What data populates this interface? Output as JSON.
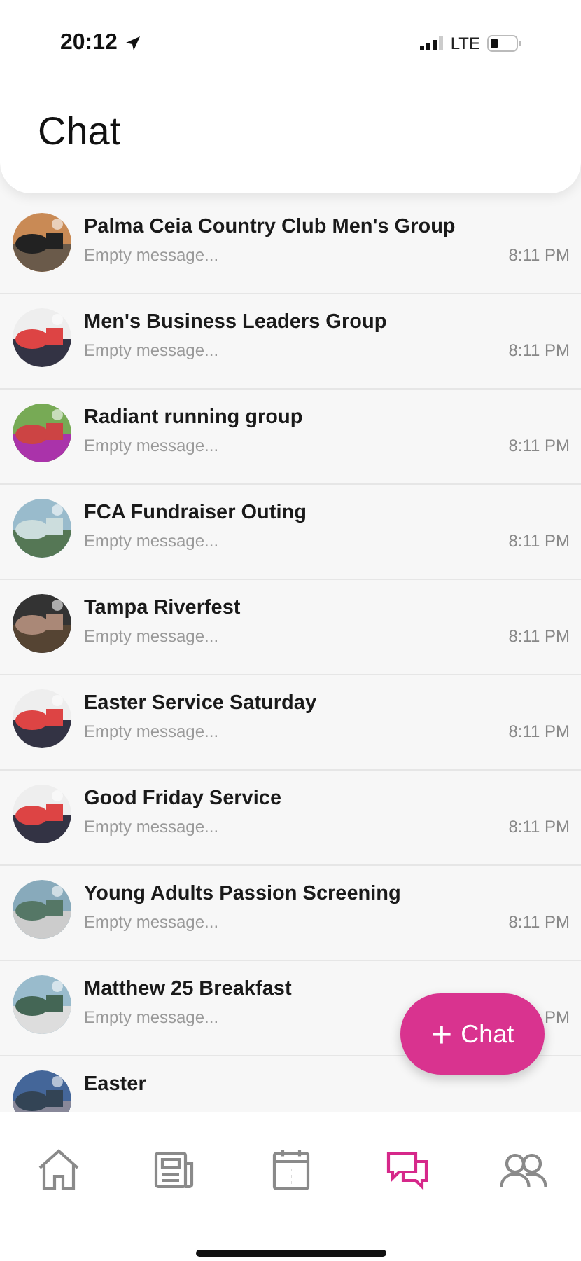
{
  "status_bar": {
    "time": "20:12",
    "network": "LTE"
  },
  "header": {
    "title": "Chat"
  },
  "chats": [
    {
      "name": "Palma Ceia Country Club Men's Group",
      "preview": "Empty message...",
      "time": "8:11 PM"
    },
    {
      "name": "Men's Business Leaders Group",
      "preview": "Empty message...",
      "time": "8:11 PM"
    },
    {
      "name": "Radiant running group",
      "preview": "Empty message...",
      "time": "8:11 PM"
    },
    {
      "name": "FCA Fundraiser Outing",
      "preview": "Empty message...",
      "time": "8:11 PM"
    },
    {
      "name": "Tampa Riverfest",
      "preview": "Empty message...",
      "time": "8:11 PM"
    },
    {
      "name": "Easter Service Saturday",
      "preview": "Empty message...",
      "time": "8:11 PM"
    },
    {
      "name": "Good Friday Service",
      "preview": "Empty message...",
      "time": "8:11 PM"
    },
    {
      "name": "Young Adults Passion Screening",
      "preview": "Empty message...",
      "time": "8:11 PM"
    },
    {
      "name": "Matthew 25 Breakfast",
      "preview": "Empty message...",
      "time": "PM"
    },
    {
      "name": "Easter"
    }
  ],
  "new_chat_button": {
    "label": "Chat",
    "icon": "+"
  },
  "tabs": [
    {
      "kind": "home",
      "selected": false
    },
    {
      "kind": "news",
      "selected": false
    },
    {
      "kind": "calendar",
      "selected": false
    },
    {
      "kind": "chat",
      "selected": true
    },
    {
      "kind": "people",
      "selected": false
    }
  ]
}
